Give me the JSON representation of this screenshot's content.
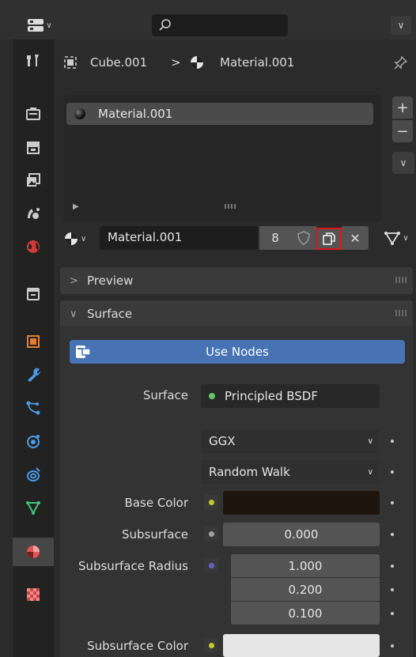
{
  "header": {
    "search_placeholder": ""
  },
  "breadcrumb": {
    "object": "Cube.001",
    "separator": ">",
    "material": "Material.001"
  },
  "material_slots": {
    "items": [
      "Material.001"
    ]
  },
  "material_selector": {
    "name": "Material.001",
    "users": "8"
  },
  "panels": {
    "preview": "Preview",
    "surface": "Surface"
  },
  "surface": {
    "use_nodes_label": "Use Nodes",
    "surface_label": "Surface",
    "surface_shader": "Principled BSDF",
    "distribution": "GGX",
    "subsurface_method": "Random Walk",
    "base_color_label": "Base Color",
    "base_color": "#1e150f",
    "subsurface_label": "Subsurface",
    "subsurface_value": "0.000",
    "subsurface_radius_label": "Subsurface Radius",
    "subsurface_radius": [
      "1.000",
      "0.200",
      "0.100"
    ],
    "subsurface_color_label": "Subsurface Color",
    "subsurface_color": "#e6e6e6"
  },
  "icons": {
    "tabs": [
      "tool-icon",
      "render-icon",
      "output-icon",
      "view-layer-icon",
      "scene-icon",
      "world-icon",
      "collection-icon",
      "object-icon",
      "modifier-icon",
      "particles-icon",
      "physics-icon",
      "constraints-icon",
      "data-icon",
      "material-icon",
      "texture-icon"
    ]
  },
  "colors": {
    "accent": "#4772b3",
    "highlight_box": "#e0141b",
    "socket_yellow": "#c7c729",
    "socket_green": "#63c763",
    "socket_grey": "#a1a1a1",
    "socket_purple": "#6363c7"
  }
}
